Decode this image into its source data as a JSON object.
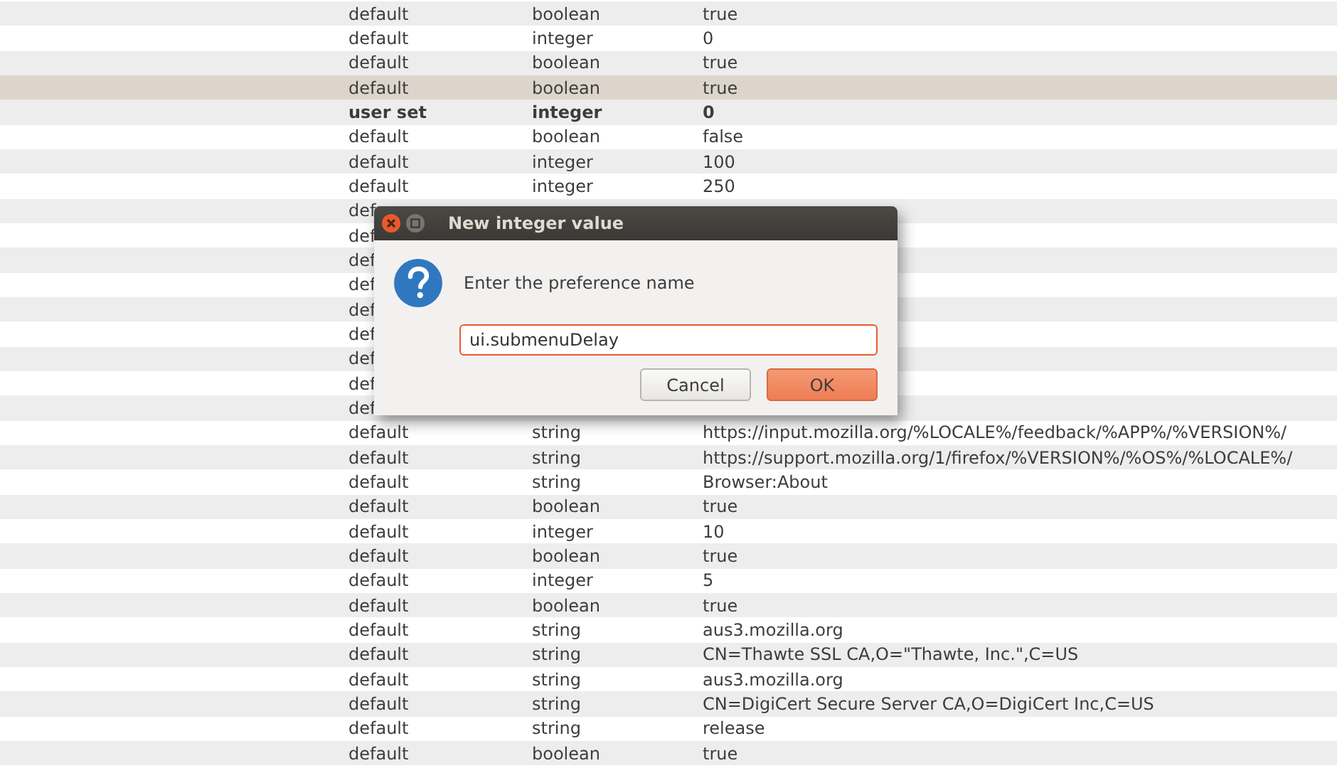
{
  "table": {
    "rows": [
      {
        "status": "default",
        "type": "boolean",
        "value": "true",
        "selected": false,
        "bold": false
      },
      {
        "status": "default",
        "type": "integer",
        "value": "0",
        "selected": false,
        "bold": false
      },
      {
        "status": "default",
        "type": "boolean",
        "value": "true",
        "selected": false,
        "bold": false
      },
      {
        "status": "default",
        "type": "boolean",
        "value": "true",
        "selected": true,
        "bold": false
      },
      {
        "status": "user set",
        "type": "integer",
        "value": "0",
        "selected": false,
        "bold": true
      },
      {
        "status": "default",
        "type": "boolean",
        "value": "false",
        "selected": false,
        "bold": false
      },
      {
        "status": "default",
        "type": "integer",
        "value": "100",
        "selected": false,
        "bold": false
      },
      {
        "status": "default",
        "type": "integer",
        "value": "250",
        "selected": false,
        "bold": false
      },
      {
        "status": "def",
        "selected": false,
        "bold": false
      },
      {
        "status": "def",
        "selected": false,
        "bold": false
      },
      {
        "status": "def",
        "selected": false,
        "bold": false
      },
      {
        "status": "def",
        "selected": false,
        "bold": false
      },
      {
        "status": "def",
        "selected": false,
        "bold": false
      },
      {
        "status": "def",
        "selected": false,
        "bold": false
      },
      {
        "status": "def",
        "selected": false,
        "bold": false
      },
      {
        "status": "def",
        "selected": false,
        "bold": false
      },
      {
        "status": "def",
        "selected": false,
        "bold": false
      },
      {
        "status": "default",
        "type": "string",
        "value": "https://input.mozilla.org/%LOCALE%/feedback/%APP%/%VERSION%/",
        "selected": false,
        "bold": false
      },
      {
        "status": "default",
        "type": "string",
        "value": "https://support.mozilla.org/1/firefox/%VERSION%/%OS%/%LOCALE%/",
        "selected": false,
        "bold": false
      },
      {
        "status": "default",
        "type": "string",
        "value": "Browser:About",
        "selected": false,
        "bold": false
      },
      {
        "status": "default",
        "type": "boolean",
        "value": "true",
        "selected": false,
        "bold": false
      },
      {
        "status": "default",
        "type": "integer",
        "value": "10",
        "selected": false,
        "bold": false
      },
      {
        "status": "default",
        "type": "boolean",
        "value": "true",
        "selected": false,
        "bold": false
      },
      {
        "status": "default",
        "type": "integer",
        "value": "5",
        "selected": false,
        "bold": false
      },
      {
        "status": "default",
        "type": "boolean",
        "value": "true",
        "selected": false,
        "bold": false
      },
      {
        "status": "default",
        "type": "string",
        "value": "aus3.mozilla.org",
        "selected": false,
        "bold": false
      },
      {
        "status": "default",
        "type": "string",
        "value": "CN=Thawte SSL CA,O=\"Thawte, Inc.\",C=US",
        "selected": false,
        "bold": false
      },
      {
        "status": "default",
        "type": "string",
        "value": "aus3.mozilla.org",
        "selected": false,
        "bold": false
      },
      {
        "status": "default",
        "type": "string",
        "value": "CN=DigiCert Secure Server CA,O=DigiCert Inc,C=US",
        "selected": false,
        "bold": false
      },
      {
        "status": "default",
        "type": "string",
        "value": "release",
        "selected": false,
        "bold": false
      },
      {
        "status": "default",
        "type": "boolean",
        "value": "true",
        "selected": false,
        "bold": false
      }
    ]
  },
  "dialog": {
    "title": "New integer value",
    "prompt": "Enter the preference name",
    "value": "ui.submenuDelay",
    "buttons": [
      {
        "label": "Cancel",
        "default": false
      },
      {
        "label": "OK",
        "default": true
      }
    ]
  }
}
